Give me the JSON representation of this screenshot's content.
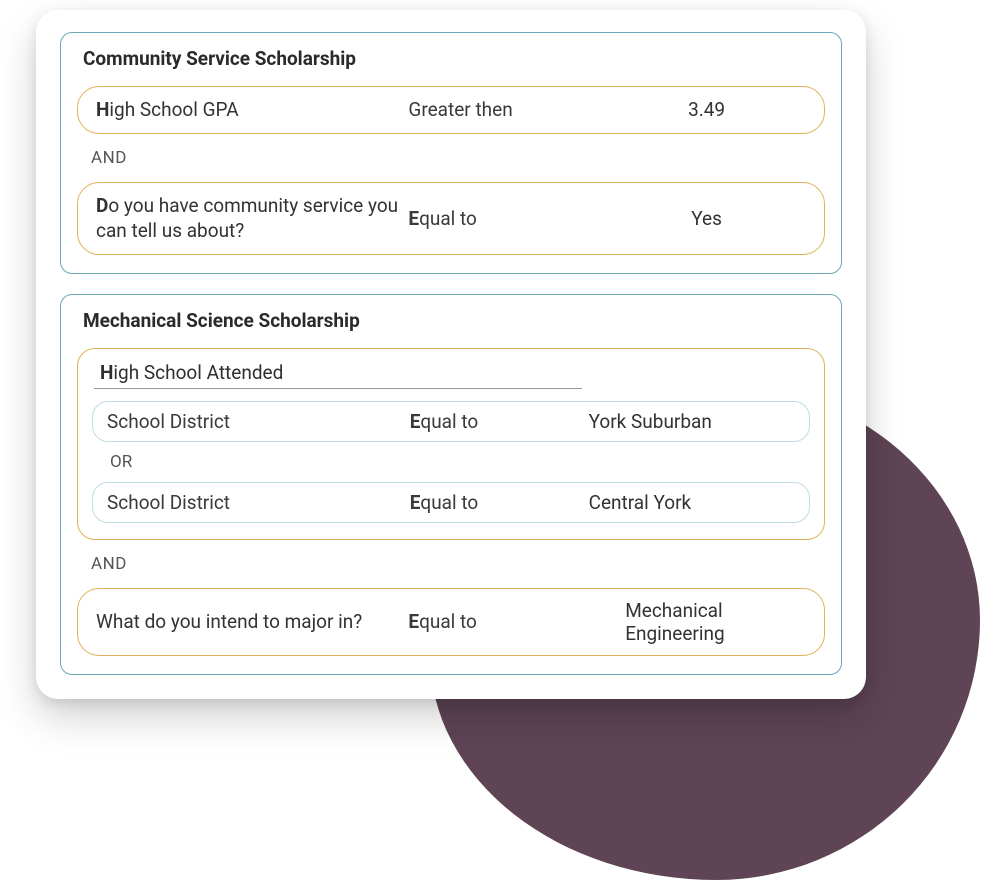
{
  "groups": [
    {
      "title": "Community Service Scholarship",
      "rules": [
        {
          "field": "High School GPA",
          "operator": "Greater then",
          "value": "3.49"
        },
        {
          "conj": "AND"
        },
        {
          "field": "Do you have community service you can tell us about?",
          "operator": "Equal to",
          "value": "Yes"
        }
      ]
    },
    {
      "title": "Mechanical Science Scholarship",
      "nested": {
        "title": "High School Attended",
        "rules": [
          {
            "field": "School District",
            "operator": "Equal to",
            "value": "York Suburban"
          },
          {
            "conj": "OR"
          },
          {
            "field": "School District",
            "operator": "Equal to",
            "value": "Central York"
          }
        ]
      },
      "conj_after_nested": "AND",
      "rules_after": [
        {
          "field": "What do you intend to major in?",
          "operator": "Equal to",
          "value": "Mechanical Engineering"
        }
      ]
    }
  ]
}
